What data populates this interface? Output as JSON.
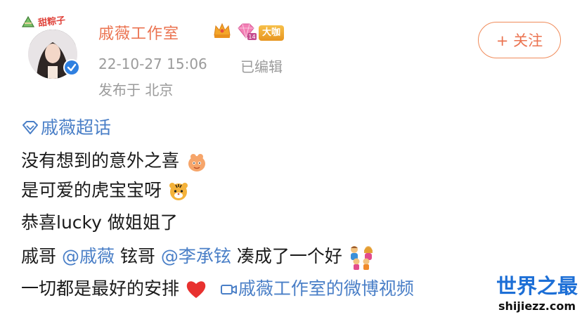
{
  "post": {
    "avatar_tag": "甜粽子",
    "username": "戚薇工作室",
    "vip_badge": "大咖",
    "timestamp": "22-10-27 15:06",
    "edited": "已编辑",
    "location": "发布于 北京",
    "follow_label": "+ 关注",
    "supertopic": "戚薇超话",
    "line1": "没有想到的意外之喜",
    "line2": "是可爱的虎宝宝呀",
    "line3": "恭喜lucky 做姐姐了",
    "line4_a": "戚哥 ",
    "mention1": "@戚薇",
    "line4_b": " 铉哥 ",
    "mention2": "@李承铉",
    "line4_c": " 凑成了一个好",
    "line5": "一切都是最好的安排",
    "video_link": "戚薇工作室的微博视频"
  },
  "watermark": {
    "main": "世界之最",
    "sub": "shijiezz.com"
  },
  "icons": {
    "verified": "verified-icon",
    "crown": "crown-badge-icon",
    "diamond": "diamond-badge-icon",
    "supertopic": "diamond-outline-icon",
    "video": "video-camera-icon",
    "emoji1": "cute-creature-emoji",
    "emoji2": "tiger-emoji",
    "emoji3": "family-emoji",
    "emoji4": "red-heart-emoji"
  },
  "colors": {
    "username": "#eb7350",
    "link": "#4a7fc7",
    "meta": "#9b9b9b",
    "watermark": "#1d6fd6"
  }
}
